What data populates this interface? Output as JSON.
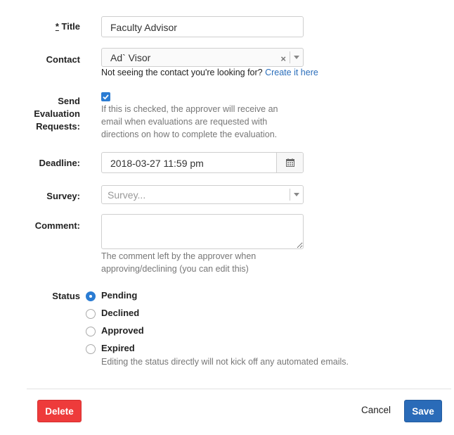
{
  "form": {
    "title": {
      "required_mark": "*",
      "label": " Title",
      "value": "Faculty Advisor"
    },
    "contact": {
      "label": "Contact",
      "value": "Ad` Visor",
      "note": "Not seeing the contact you're looking for?",
      "create_link": "Create it here"
    },
    "send_eval": {
      "label_l1": "Send",
      "label_l2": "Evaluation",
      "label_l3": "Requests:",
      "checked": true,
      "help_l1": "If this is checked, the approver will receive an",
      "help_l2": "email when evaluations are requested with",
      "help_l3": "directions on how to complete the evaluation."
    },
    "deadline": {
      "label": "Deadline:",
      "value": "2018-03-27 11:59 pm"
    },
    "survey": {
      "label": "Survey:",
      "placeholder": "Survey..."
    },
    "comment": {
      "label": "Comment:",
      "help_l1": "The comment left by the approver when",
      "help_l2": "approving/declining (you can edit this)"
    },
    "status": {
      "label": "Status",
      "options": [
        "Pending",
        "Declined",
        "Approved",
        "Expired"
      ],
      "selected": "Pending",
      "help": "Editing the status directly will not kick off any automated emails."
    }
  },
  "footer": {
    "delete_label": "Delete",
    "cancel_label": "Cancel",
    "save_label": "Save"
  },
  "colors": {
    "primary": "#2b7cd3",
    "danger": "#ee3b3b",
    "save": "#2a6bb8",
    "link": "#2a6ebb"
  },
  "icons": {
    "calendar": "calendar-icon",
    "check": "check-icon",
    "clear": "clear-icon",
    "caret": "caret-down-icon"
  }
}
